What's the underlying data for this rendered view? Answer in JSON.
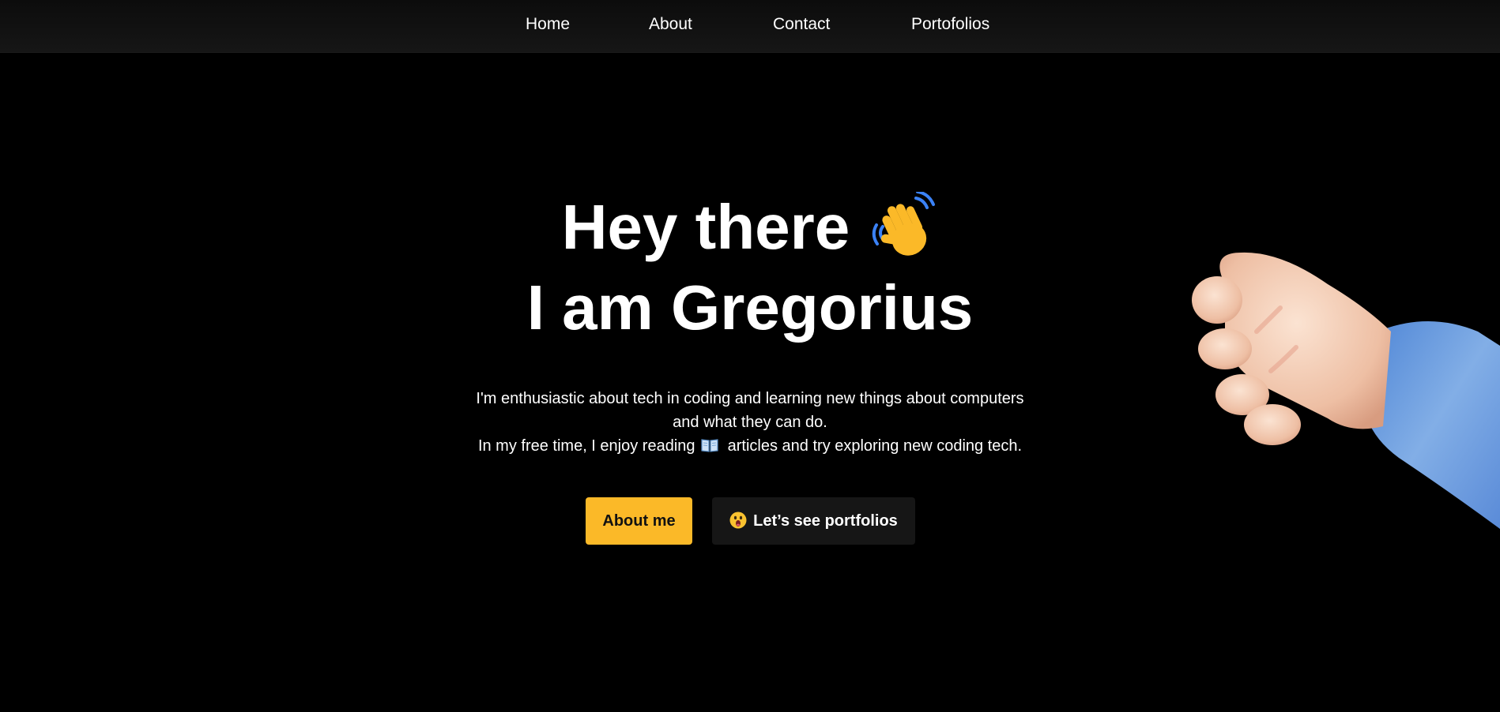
{
  "nav": {
    "home": "Home",
    "about": "About",
    "contact": "Contact",
    "portfolios": "Portofolios"
  },
  "hero": {
    "title_line1": "Hey there",
    "title_line2": "I am Gregorius",
    "wave_icon": "waving-hand-emoji",
    "desc_line1": "I'm enthusiastic about tech in coding and learning new things about computers",
    "desc_line2": "and what they can do.",
    "desc_line3_before": "In my free time, I enjoy reading",
    "desc_line3_after": "articles and try exploring new coding tech.",
    "book_icon": "open-book-emoji"
  },
  "buttons": {
    "about_label": "About me",
    "portfolios_label": "Let’s see portfolios",
    "portfolios_icon": "astonished-face-emoji"
  },
  "colors": {
    "background": "#000000",
    "accent": "#fbb928",
    "secondary_button": "#161616",
    "text": "#ffffff"
  }
}
